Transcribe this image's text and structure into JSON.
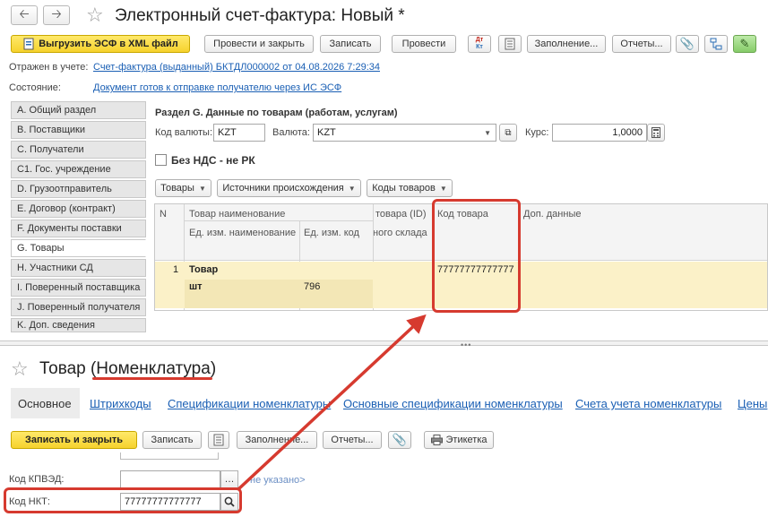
{
  "header": {
    "back_icon": "arrow-left-icon",
    "forward_icon": "arrow-right-icon",
    "title": "Электронный счет-фактура:  Новый *"
  },
  "toolbar": {
    "export_label": "Выгрузить ЭСФ в XML файл",
    "post_close_label": "Провести и закрыть",
    "save_label": "Записать",
    "post_label": "Провести",
    "dtkt_label": "Дт/Кт",
    "fill_label": "Заполнение...",
    "reports_label": "Отчеты..."
  },
  "info": {
    "reflected_label": "Отражен в учете:",
    "reflected_link": "Счет-фактура (выданный) БКТДЛ000002 от 04.08.2026 7:29:34",
    "state_label": "Состояние:",
    "state_link": "Документ готов к отправке получателю через ИС ЭСФ"
  },
  "sidebar": {
    "items": [
      {
        "label": "A. Общий раздел"
      },
      {
        "label": "B. Поставщики"
      },
      {
        "label": "C. Получатели"
      },
      {
        "label": "C1. Гос. учреждение"
      },
      {
        "label": "D. Грузоотправитель"
      },
      {
        "label": "E. Договор (контракт)"
      },
      {
        "label": "F. Документы поставки"
      },
      {
        "label": "G. Товары"
      },
      {
        "label": "H. Участники СД"
      },
      {
        "label": "I. Поверенный поставщика"
      },
      {
        "label": "J. Поверенный получателя"
      },
      {
        "label": "K. Доп. сведения"
      }
    ],
    "active_index": 7
  },
  "section": {
    "title": "Раздел G. Данные по товарам (работам, услугам)",
    "currency_code_label": "Код валюты:",
    "currency_code_value": "KZT",
    "currency_label": "Валюта:",
    "currency_value": "KZT",
    "rate_label": "Курс:",
    "rate_value": "1,0000",
    "no_vat_label": "Без НДС - не РК",
    "goods_btn": "Товары",
    "origin_btn": "Источники происхождения",
    "codes_btn": "Коды товаров"
  },
  "grid": {
    "headers": {
      "n": "N",
      "name": "Товар наименование",
      "unit_name": "Ед. изм. наименование",
      "unit_code": "Ед. изм. код",
      "id_top": "товара (ID)",
      "id_bottom": "ного склада",
      "code": "Код товара",
      "extra": "Доп. данные"
    },
    "rows": [
      {
        "n": "1",
        "name": "Товар",
        "unit": "шт",
        "unit_code": "796",
        "code": "77777777777777"
      }
    ]
  },
  "bottom": {
    "title": "Товар (Номенклатура)",
    "tabs": [
      "Основное",
      "Штрихкоды",
      "Спецификации номенклатуры",
      "Основные спецификации номенклатуры",
      "Счета учета номенклатуры",
      "Цены"
    ],
    "toolbar": {
      "save_close_label": "Записать и закрыть",
      "save_label": "Записать",
      "fill_label": "Заполнение...",
      "reports_label": "Отчеты...",
      "label_label": "Этикетка"
    },
    "kpved_label": "Код КПВЭД:",
    "kpved_hint": "не указано>",
    "nkt_label": "Код НКТ:",
    "nkt_value": "77777777777777"
  },
  "colors": {
    "accent_yellow": "#f6d22d",
    "selected_row": "#fbf1c8",
    "annotation_red": "#d63a2f",
    "link_blue": "#1a5fb4"
  }
}
